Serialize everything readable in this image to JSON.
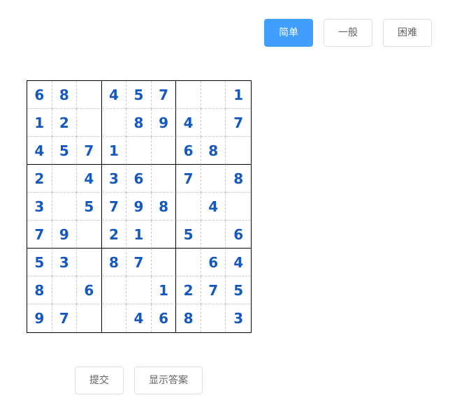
{
  "difficulty": {
    "easy_label": "简单",
    "normal_label": "一般",
    "hard_label": "困难",
    "selected": "easy"
  },
  "actions": {
    "submit_label": "提交",
    "show_answer_label": "显示答案"
  },
  "colors": {
    "primary": "#409eff",
    "digit": "#1558c0",
    "grid_line": "#000000",
    "cell_divider": "#c8c8c8"
  },
  "board": [
    [
      "6",
      "8",
      "",
      "4",
      "5",
      "7",
      "",
      "",
      "1"
    ],
    [
      "1",
      "2",
      "",
      "",
      "8",
      "9",
      "4",
      "",
      "7"
    ],
    [
      "4",
      "5",
      "7",
      "1",
      "",
      "",
      "6",
      "8",
      ""
    ],
    [
      "2",
      "",
      "4",
      "3",
      "6",
      "",
      "7",
      "",
      "8"
    ],
    [
      "3",
      "",
      "5",
      "7",
      "9",
      "8",
      "",
      "4",
      ""
    ],
    [
      "7",
      "9",
      "",
      "2",
      "1",
      "",
      "5",
      "",
      "6"
    ],
    [
      "5",
      "3",
      "",
      "8",
      "7",
      "",
      "",
      "6",
      "4"
    ],
    [
      "8",
      "",
      "6",
      "",
      "",
      "1",
      "2",
      "7",
      "5"
    ],
    [
      "9",
      "7",
      "",
      "",
      "4",
      "6",
      "8",
      "",
      "3"
    ]
  ]
}
